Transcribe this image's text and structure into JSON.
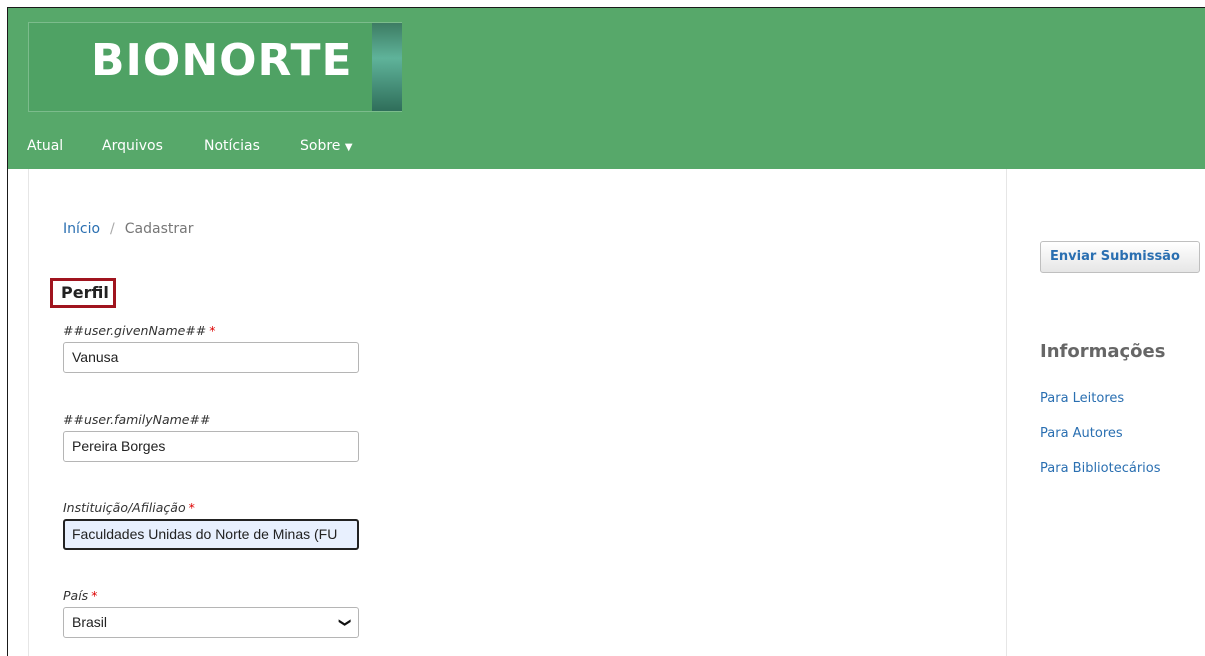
{
  "header": {
    "logo_text": "BIONORTE",
    "nav": [
      {
        "label": "Atual"
      },
      {
        "label": "Arquivos"
      },
      {
        "label": "Notícias"
      },
      {
        "label": "Sobre"
      }
    ],
    "background_color": "#57a86a"
  },
  "breadcrumb": {
    "home": "Início",
    "separator": "/",
    "current": "Cadastrar"
  },
  "form": {
    "section_title": "Perfil",
    "required_marker": "*",
    "given_name_label": "##user.givenName##",
    "given_name_value": "Vanusa",
    "family_name_label": "##user.familyName##",
    "family_name_value": "Pereira Borges",
    "affiliation_label": "Instituição/Afiliação",
    "affiliation_value": "Faculdades Unidas do Norte de Minas (FU",
    "country_label": "País",
    "country_value": "Brasil"
  },
  "sidebar": {
    "submit_button": "Enviar Submissão",
    "info_title": "Informações",
    "links": [
      {
        "label": "Para Leitores"
      },
      {
        "label": "Para Autores"
      },
      {
        "label": "Para Bibliotecários"
      }
    ]
  },
  "colors": {
    "link": "#2a6fb1",
    "highlight_border": "#a0141e",
    "required": "#dd0000"
  }
}
